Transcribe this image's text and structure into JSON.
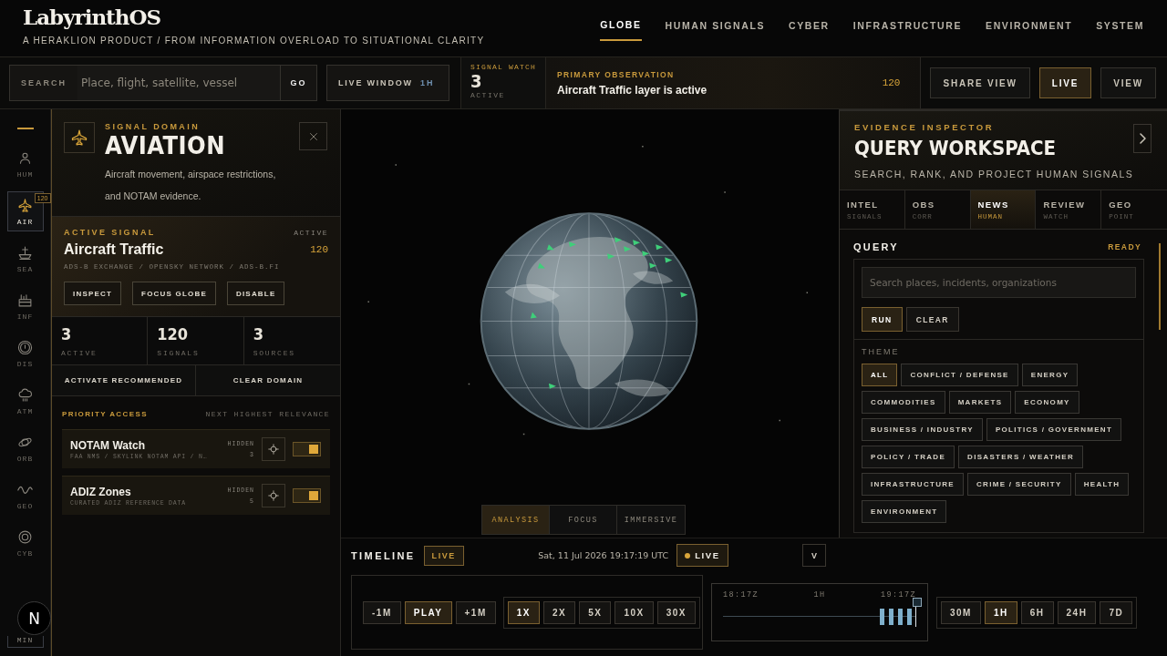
{
  "app": {
    "logo": "LabyrinthOS",
    "tagline": "A HERAKLION PRODUCT / FROM INFORMATION OVERLOAD TO SITUATIONAL CLARITY"
  },
  "nav": [
    {
      "label": "GLOBE",
      "selected": true
    },
    {
      "label": "HUMAN SIGNALS",
      "selected": false
    },
    {
      "label": "CYBER",
      "selected": false
    },
    {
      "label": "INFRASTRUCTURE",
      "selected": false
    },
    {
      "label": "ENVIRONMENT",
      "selected": false
    },
    {
      "label": "SYSTEM",
      "selected": false
    }
  ],
  "toolbar": {
    "search": {
      "label": "SEARCH",
      "placeholder": "Place, flight, satellite, vessel",
      "button": "GO"
    },
    "live_window": {
      "label": "LIVE WINDOW",
      "value": "1H"
    },
    "signal_watch": {
      "label": "SIGNAL WATCH",
      "value": "3",
      "caption": "ACTIVE"
    },
    "observation": {
      "label": "PRIMARY OBSERVATION",
      "text": "Aircraft Traffic layer is active",
      "count": "120"
    },
    "buttons": [
      {
        "label": "SHARE VIEW",
        "selected": false
      },
      {
        "label": "LIVE",
        "selected": true
      },
      {
        "label": "VIEW",
        "selected": false
      }
    ]
  },
  "rail": {
    "items": [
      {
        "kind": "person",
        "label": "HUM",
        "selected": false
      },
      {
        "kind": "plane",
        "label": "AIR",
        "selected": true,
        "badge": "120"
      },
      {
        "kind": "ship",
        "label": "SEA",
        "selected": false
      },
      {
        "kind": "factory",
        "label": "INF",
        "selected": false
      },
      {
        "kind": "alert",
        "label": "DIS",
        "selected": false
      },
      {
        "kind": "cloud",
        "label": "ATM",
        "selected": false
      },
      {
        "kind": "planet",
        "label": "ORB",
        "selected": false
      },
      {
        "kind": "wave",
        "label": "GEO",
        "selected": false
      },
      {
        "kind": "target",
        "label": "CYB",
        "selected": false
      }
    ],
    "minimize": "MIN"
  },
  "domain_panel": {
    "eyebrow": "SIGNAL DOMAIN",
    "title": "AVIATION",
    "description": "Aircraft movement, airspace restrictions, and NOTAM evidence.",
    "active_signal": {
      "eyebrow": "ACTIVE SIGNAL",
      "status": "ACTIVE",
      "name": "Aircraft Traffic",
      "count": "120",
      "sources": "ADS-B EXCHANGE / OPENSKY NETWORK / ADS-B.FI",
      "actions": [
        "INSPECT",
        "FOCUS GLOBE",
        "DISABLE"
      ]
    },
    "stats": [
      {
        "value": "3",
        "label": "ACTIVE"
      },
      {
        "value": "120",
        "label": "SIGNALS"
      },
      {
        "value": "3",
        "label": "SOURCES"
      }
    ],
    "actions": [
      "ACTIVATE RECOMMENDED",
      "CLEAR DOMAIN"
    ],
    "priority": {
      "title": "PRIORITY ACCESS",
      "hint": "NEXT HIGHEST RELEVANCE",
      "layers": [
        {
          "name": "NOTAM Watch",
          "sources": "FAA NMS / SKYLINK NOTAM API / N…",
          "status": "HIDDEN",
          "count": "3",
          "on": true
        },
        {
          "name": "ADIZ Zones",
          "sources": "CURATED ADIZ REFERENCE DATA",
          "status": "HIDDEN",
          "count": "5",
          "on": true
        }
      ]
    }
  },
  "globe_view": {
    "kind": "picture",
    "modes": [
      {
        "label": "ANALYSIS",
        "selected": true
      },
      {
        "label": "FOCUS",
        "selected": false
      },
      {
        "label": "IMMERSIVE",
        "selected": false
      }
    ]
  },
  "inspector": {
    "eyebrow": "EVIDENCE INSPECTOR",
    "title": "QUERY WORKSPACE",
    "subtitle": "SEARCH, RANK, AND PROJECT HUMAN SIGNALS",
    "tabs": [
      {
        "label": "INTEL",
        "sub": "SIGNALS",
        "selected": false
      },
      {
        "label": "OBS",
        "sub": "CORR",
        "selected": false
      },
      {
        "label": "NEWS",
        "sub": "HUMAN",
        "selected": true
      },
      {
        "label": "REVIEW",
        "sub": "WATCH",
        "selected": false
      },
      {
        "label": "GEO",
        "sub": "POINT",
        "selected": false
      }
    ],
    "query": {
      "title": "QUERY",
      "status": "READY",
      "placeholder": "Search places, incidents, organizations",
      "buttons": [
        {
          "label": "RUN",
          "selected": true
        },
        {
          "label": "CLEAR",
          "selected": false
        }
      ]
    },
    "theme": {
      "title": "THEME",
      "chips": [
        {
          "label": "ALL",
          "selected": true
        },
        {
          "label": "CONFLICT / DEFENSE",
          "selected": false
        },
        {
          "label": "ENERGY",
          "selected": false
        },
        {
          "label": "COMMODITIES",
          "selected": false
        },
        {
          "label": "MARKETS",
          "selected": false
        },
        {
          "label": "ECONOMY",
          "selected": false
        },
        {
          "label": "BUSINESS / INDUSTRY",
          "selected": false
        },
        {
          "label": "POLITICS / GOVERNMENT",
          "selected": false
        },
        {
          "label": "POLICY / TRADE",
          "selected": false
        },
        {
          "label": "DISASTERS / WEATHER",
          "selected": false
        },
        {
          "label": "INFRASTRUCTURE",
          "selected": false
        },
        {
          "label": "CRIME / SECURITY",
          "selected": false
        },
        {
          "label": "HEALTH",
          "selected": false
        },
        {
          "label": "ENVIRONMENT",
          "selected": false
        }
      ]
    }
  },
  "timeline": {
    "title": "TIMELINE",
    "badge": "LIVE",
    "datetime": "Sat, 11 Jul 2026 19:17:19 UTC",
    "live_button": "LIVE",
    "collapse_button": "V",
    "steps": [
      {
        "label": "-1M",
        "selected": false
      },
      {
        "label": "PLAY",
        "selected": true
      },
      {
        "label": "+1M",
        "selected": false
      }
    ],
    "speeds": [
      {
        "label": "1X",
        "selected": true
      },
      {
        "label": "2X",
        "selected": false
      },
      {
        "label": "5X",
        "selected": false
      },
      {
        "label": "10X",
        "selected": false
      },
      {
        "label": "30X",
        "selected": false
      }
    ],
    "scrubber": {
      "start": "18:17Z",
      "middle": "1H",
      "end": "19:17Z",
      "level": 1
    },
    "ranges": [
      {
        "label": "30M",
        "selected": false
      },
      {
        "label": "1H",
        "selected": true
      },
      {
        "label": "6H",
        "selected": false
      },
      {
        "label": "24H",
        "selected": false
      },
      {
        "label": "7D",
        "selected": false
      }
    ]
  },
  "dev_badge": "N"
}
